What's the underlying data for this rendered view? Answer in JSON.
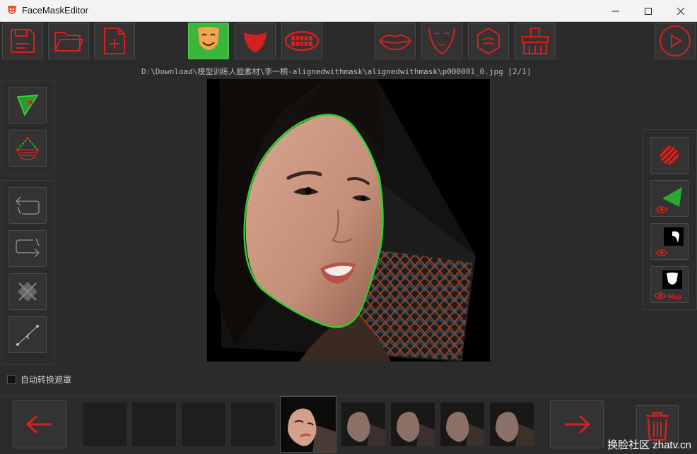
{
  "window": {
    "title": "FaceMaskEditor"
  },
  "file_path": "D:\\Download\\模型训练人脸素材\\李一桐-alignedwithmask\\alignedwithmask\\p000001_0.jpg [2/1]",
  "options": {
    "auto_convert_mask_label": "自动转换遮罩"
  },
  "toolbar": {
    "buttons": [
      {
        "icon": "save-icon"
      },
      {
        "icon": "open-folder-icon"
      },
      {
        "icon": "new-file-icon"
      },
      {
        "icon": "face-mask-icon",
        "active": true
      },
      {
        "icon": "mouth-tongue-icon"
      },
      {
        "icon": "teeth-icon"
      },
      {
        "icon": "lips-icon"
      },
      {
        "icon": "face-outline-icon"
      },
      {
        "icon": "nose-icon"
      },
      {
        "icon": "brush-clean-icon"
      },
      {
        "icon": "play-icon"
      }
    ]
  },
  "left_tools": [
    "polygon-tool-icon",
    "face-outline-tool-icon",
    "undo-icon",
    "redo-icon",
    "delete-point-icon",
    "line-tool-icon"
  ],
  "right_tools": [
    "hatch-circle-icon",
    "view-polygon-icon",
    "view-mask-icon",
    "view-mask-map-icon"
  ],
  "right_tool_labels": {
    "mask_map_suffix": "Map"
  },
  "thumbnails": {
    "count_empty": 4,
    "count_filled": 4
  },
  "colors": {
    "accent_red": "#d42020",
    "active_green": "#3cb53c",
    "mask_line": "#2fd12f"
  },
  "watermark": "换脸社区 zhatv.cn"
}
